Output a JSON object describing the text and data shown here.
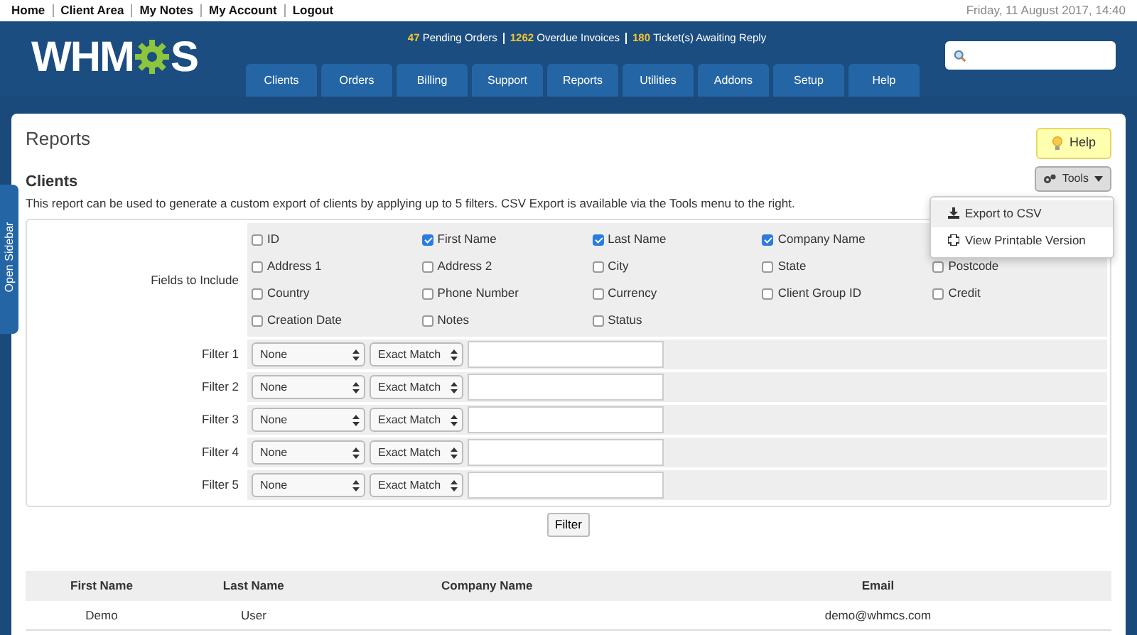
{
  "top_links": [
    "Home",
    "Client Area",
    "My Notes",
    "My Account",
    "Logout"
  ],
  "date": "Friday, 11 August 2017, 14:40",
  "logo": "WHM",
  "logo_tail": "S",
  "stats": [
    {
      "count": "47",
      "label": "Pending Orders"
    },
    {
      "count": "1262",
      "label": "Overdue Invoices"
    },
    {
      "count": "180",
      "label": "Ticket(s) Awaiting Reply"
    }
  ],
  "nav_tabs": [
    "Clients",
    "Orders",
    "Billing",
    "Support",
    "Reports",
    "Utilities",
    "Addons",
    "Setup",
    "Help"
  ],
  "sidebar_toggle": "Open Sidebar",
  "page_title": "Reports",
  "help_button": "Help",
  "report_title": "Clients",
  "tools_button": "Tools",
  "tools_menu": [
    "Export to CSV",
    "View Printable Version"
  ],
  "description": "This report can be used to generate a custom export of clients by applying up to 5 filters. CSV Export is available via the Tools menu to the right.",
  "fields_label": "Fields to Include",
  "field_rows": [
    [
      {
        "label": "ID",
        "checked": false
      },
      {
        "label": "First Name",
        "checked": true
      },
      {
        "label": "Last Name",
        "checked": true
      },
      {
        "label": "Company Name",
        "checked": true
      }
    ],
    [
      {
        "label": "Address 1",
        "checked": false
      },
      {
        "label": "Address 2",
        "checked": false
      },
      {
        "label": "City",
        "checked": false
      },
      {
        "label": "State",
        "checked": false
      },
      {
        "label": "Postcode",
        "checked": false
      }
    ],
    [
      {
        "label": "Country",
        "checked": false
      },
      {
        "label": "Phone Number",
        "checked": false
      },
      {
        "label": "Currency",
        "checked": false
      },
      {
        "label": "Client Group ID",
        "checked": false
      },
      {
        "label": "Credit",
        "checked": false
      }
    ],
    [
      {
        "label": "Creation Date",
        "checked": false
      },
      {
        "label": "Notes",
        "checked": false
      },
      {
        "label": "Status",
        "checked": false
      }
    ]
  ],
  "filters": [
    {
      "label": "Filter 1",
      "field": "None",
      "match": "Exact Match"
    },
    {
      "label": "Filter 2",
      "field": "None",
      "match": "Exact Match"
    },
    {
      "label": "Filter 3",
      "field": "None",
      "match": "Exact Match"
    },
    {
      "label": "Filter 4",
      "field": "None",
      "match": "Exact Match"
    },
    {
      "label": "Filter 5",
      "field": "None",
      "match": "Exact Match"
    }
  ],
  "filter_button": "Filter",
  "results": {
    "columns": [
      "First Name",
      "Last Name",
      "Company Name",
      "Email"
    ],
    "rows": [
      [
        "Demo",
        "User",
        "",
        "demo@whmcs.com"
      ]
    ]
  }
}
